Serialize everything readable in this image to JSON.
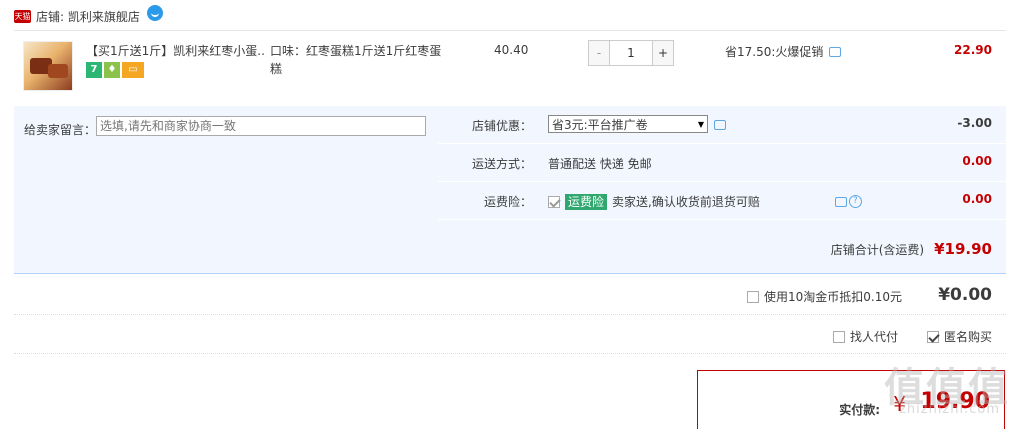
{
  "shop": {
    "badge": "天猫",
    "name": "店铺: 凯利来旗舰店"
  },
  "item": {
    "title": "【买1斤送1斤】凯利来红枣小蛋...",
    "sku": "口味：红枣蛋糕1斤送1斤红枣蛋糕",
    "price": "40.40",
    "quantity": "1",
    "minus": "-",
    "plus": "+",
    "promo": "省17.50:火爆促销",
    "subtotal": "22.90",
    "badges": [
      "7",
      "shield",
      "card"
    ]
  },
  "message": {
    "label": "给卖家留言：",
    "placeholder": "选填,请先和商家协商一致"
  },
  "options": {
    "coupon": {
      "label": "店铺优惠：",
      "selected": "省3元:平台推广卷",
      "amount": "-3.00"
    },
    "shipping": {
      "label": "运送方式：",
      "value": "普通配送 快递 免邮",
      "amount": "0.00"
    },
    "insurance": {
      "label": "运费险：",
      "tag": "运费险",
      "value": "卖家送,确认收货前退货可赔",
      "amount": "0.00"
    }
  },
  "shop_total": {
    "label": "店铺合计(含运费)",
    "value": "¥19.90"
  },
  "coins": {
    "label": "使用10淘金币抵扣0.10元",
    "value": "¥0.00"
  },
  "extras": {
    "proxy_label": "找人代付",
    "anonymous_label": "匿名购买"
  },
  "payment": {
    "label": "实付款:",
    "currency": "¥",
    "value": "19.90"
  },
  "watermark": {
    "main": "值值值",
    "sub": "zhizhizhi.com"
  }
}
